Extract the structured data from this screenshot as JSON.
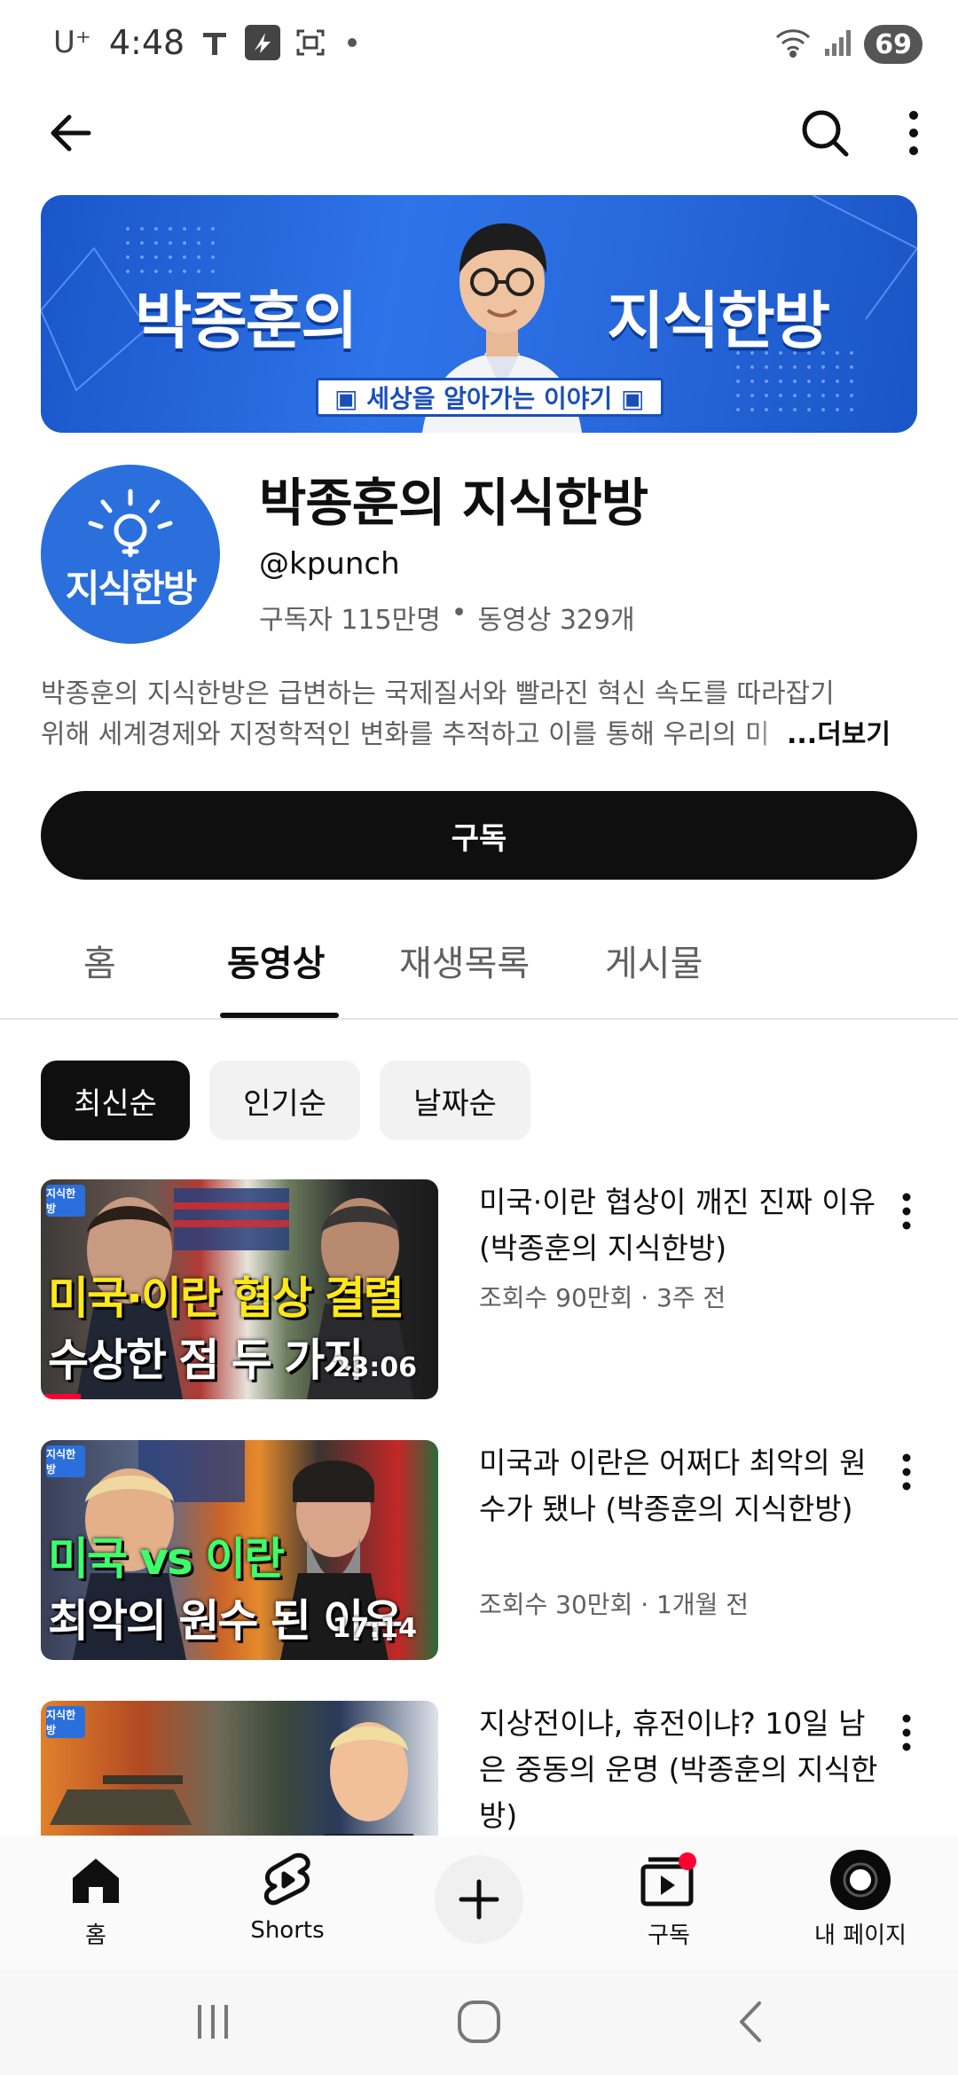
{
  "status_bar": {
    "carrier": "U⁺",
    "time": "4:48",
    "icons": [
      "tmap-icon",
      "app-icon",
      "screenshot-icon",
      "notification-dot"
    ],
    "battery": "69"
  },
  "topbar": {
    "back_icon": "arrow-left-icon",
    "search_icon": "search-icon",
    "more_icon": "more-vert-icon"
  },
  "banner": {
    "left_text": "박종훈의",
    "right_text": "지식한방",
    "tagline": "▣ 세상을 알아가는 이야기 ▣"
  },
  "channel": {
    "avatar_text": "지식한방",
    "name": "박종훈의 지식한방",
    "handle": "@kpunch",
    "subscribers": "구독자 115만명",
    "separator": "•",
    "videos": "동영상 329개",
    "description_line1": "박종훈의 지식한방은 급변하는 국제질서와 빨라진 혁신 속도를 따라잡기",
    "description_line2": "위해 세계경제와 지정학적인 변화를 추적하고 이를 통해 우리의 미",
    "more_label": "...더보기",
    "subscribe_label": "구독"
  },
  "tabs": [
    {
      "label": "홈",
      "active": false
    },
    {
      "label": "동영상",
      "active": true
    },
    {
      "label": "재생목록",
      "active": false
    },
    {
      "label": "게시물",
      "active": false
    }
  ],
  "chips": [
    {
      "label": "최신순",
      "active": true
    },
    {
      "label": "인기순",
      "active": false
    },
    {
      "label": "날짜순",
      "active": false
    }
  ],
  "videos": [
    {
      "title": "미국·이란 협상이 깨진 진짜 이유 (박종훈의 지식한방)",
      "meta": "조회수 90만회 · 3주 전",
      "thumb_line1": "미국·이란 협상 결렬",
      "thumb_line2": "수상한 점 두 가지",
      "duration": "23:06",
      "thumb_logo": "지식한방",
      "watched_fraction": 0.1
    },
    {
      "title": "미국과 이란은 어쩌다 최악의 원수가 됐나 (박종훈의 지식한방)",
      "meta": "조회수 30만회 · 1개월 전",
      "thumb_line1": "미국 vs 이란",
      "thumb_line2": "최악의 원수 된 이유",
      "duration": "17:14",
      "thumb_logo": "지식한방",
      "watched_fraction": 0
    },
    {
      "title": "지상전이냐, 휴전이냐? 10일 남은 중동의 운명 (박종훈의 지식한방)",
      "meta": "",
      "thumb_line1": "",
      "thumb_line2": "",
      "duration": "",
      "thumb_logo": "지식한방",
      "watched_fraction": 0
    }
  ],
  "bottom_nav": {
    "home": "홈",
    "shorts": "Shorts",
    "create_icon": "plus-icon",
    "subscriptions": "구독",
    "my_page": "내 페이지"
  },
  "system_nav": [
    "recents-icon",
    "home-icon",
    "back-icon"
  ],
  "colors": {
    "text_primary": "#0f0f0f",
    "text_secondary": "#606060",
    "banner_blue": "#2e73e8",
    "accent_red": "#ff0033",
    "thumb_yellow": "#ffe81a",
    "thumb_green": "#3cff6a"
  }
}
